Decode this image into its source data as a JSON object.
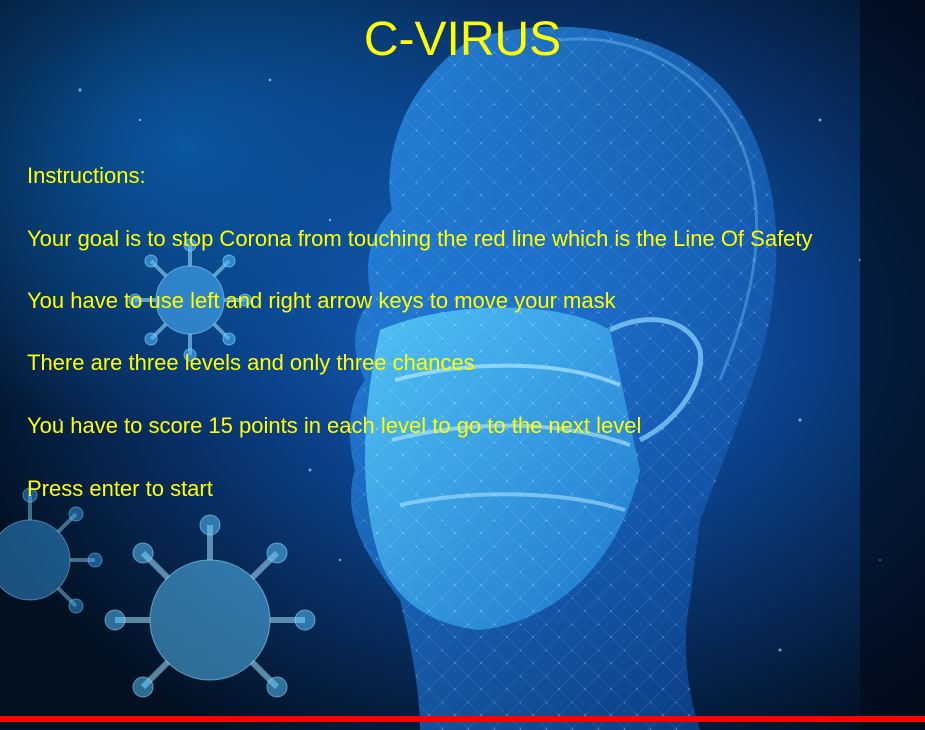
{
  "game": {
    "title": "C-VIRUS",
    "instructions": {
      "heading": "Instructions:",
      "lines": [
        "Your goal is to stop Corona from touching the red line which is the Line Of Safety",
        "You have to use left and right arrow keys to move your mask",
        "There are three levels and only three chances",
        "You have to score 15 points in each level to go to the next level",
        "Press enter to start"
      ]
    }
  },
  "colors": {
    "text": "#ffff00",
    "safety_line": "#ff0000",
    "background_dark": "#03111f",
    "background_glow": "#1f6fd6"
  },
  "icons": [
    "virus-icon",
    "face-mask-icon",
    "human-head-icon"
  ]
}
